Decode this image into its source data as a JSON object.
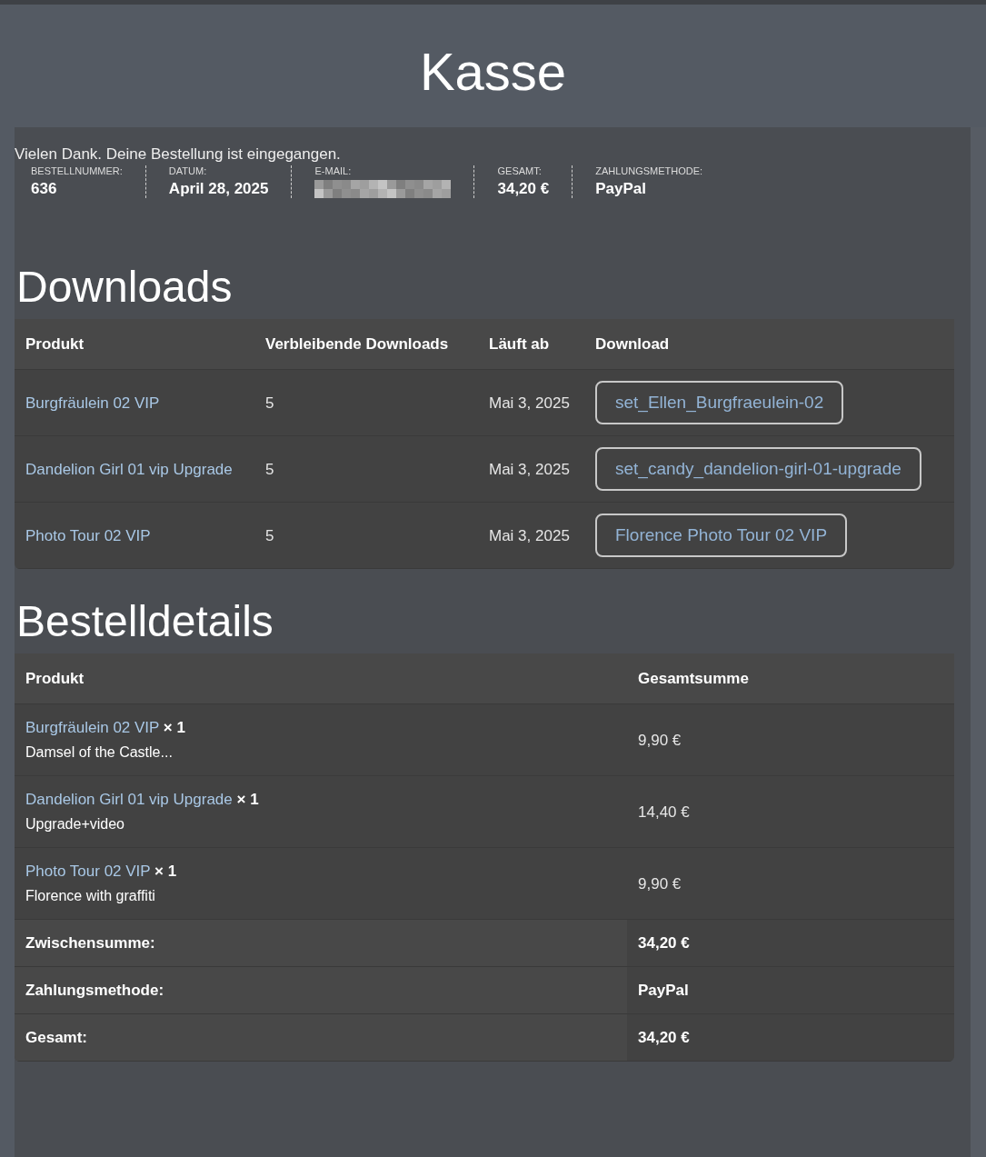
{
  "page_title": "Kasse",
  "thank_you": "Vielen Dank. Deine Bestellung ist eingegangen.",
  "overview": [
    {
      "label": "BESTELLNUMMER:",
      "value": "636",
      "kind": "text"
    },
    {
      "label": "DATUM:",
      "value": "April 28, 2025",
      "kind": "text"
    },
    {
      "label": "E-MAIL:",
      "kind": "hidden"
    },
    {
      "label": "GESAMT:",
      "value": "34,20 €",
      "kind": "text"
    },
    {
      "label": "ZAHLUNGSMETHODE:",
      "value": "PayPal",
      "kind": "text"
    }
  ],
  "downloads": {
    "title": "Downloads",
    "columns": [
      "Produkt",
      "Verbleibende Downloads",
      "Läuft ab",
      "Download"
    ],
    "rows": [
      {
        "product": "Burgfräulein 02 VIP",
        "remaining": "5",
        "expires": "Mai 3, 2025",
        "file": "set_Ellen_Burgfraeulein-02"
      },
      {
        "product": "Dandelion Girl 01 vip Upgrade",
        "remaining": "5",
        "expires": "Mai 3, 2025",
        "file": "set_candy_dandelion-girl-01-upgrade"
      },
      {
        "product": "Photo Tour 02 VIP",
        "remaining": "5",
        "expires": "Mai 3, 2025",
        "file": "Florence Photo Tour 02 VIP"
      }
    ]
  },
  "order_details": {
    "title": "Bestelldetails",
    "columns": [
      "Produkt",
      "Gesamtsumme"
    ],
    "items": [
      {
        "product": "Burgfräulein 02 VIP",
        "quantity": "× 1",
        "note": "Damsel of the Castle...",
        "total": "9,90 €"
      },
      {
        "product": "Dandelion Girl 01 vip Upgrade",
        "quantity": "× 1",
        "note": "Upgrade+video",
        "total": "14,40 €"
      },
      {
        "product": "Photo Tour 02 VIP",
        "quantity": "× 1",
        "note": "Florence with graffiti",
        "total": "9,90 €"
      }
    ],
    "totals": [
      {
        "label": "Zwischensumme:",
        "value": "34,20 €"
      },
      {
        "label": "Zahlungsmethode:",
        "value": "PayPal"
      },
      {
        "label": "Gesamt:",
        "value": "34,20 €"
      }
    ]
  }
}
